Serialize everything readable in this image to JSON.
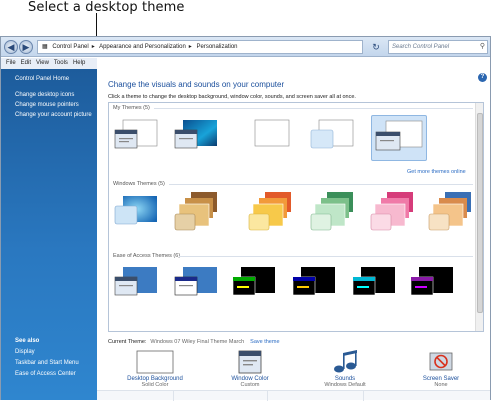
{
  "callout": {
    "text": "Select a desktop theme"
  },
  "address": {
    "crumbs": [
      "Control Panel",
      "Appearance and Personalization",
      "Personalization"
    ],
    "search_placeholder": "Search Control Panel"
  },
  "menu": [
    "File",
    "Edit",
    "View",
    "Tools",
    "Help"
  ],
  "sidebar": {
    "home": "Control Panel Home",
    "links": [
      "Change desktop icons",
      "Change mouse pointers",
      "Change your account picture"
    ],
    "see_also_label": "See also",
    "see_also": [
      "Display",
      "Taskbar and Start Menu",
      "Ease of Access Center"
    ]
  },
  "main": {
    "title": "Change the visuals and sounds on your computer",
    "subtitle": "Click a theme to change the desktop background, window color, sounds, and screen saver all at once."
  },
  "themes": {
    "my_themes": "My Themes (5)",
    "get_more": "Get more themes online",
    "windows_themes": "Windows Themes (5)",
    "ease_themes": "Ease of Access Themes (6)"
  },
  "current": {
    "label": "Current Theme:",
    "value": "Windows 07 Wiley Final Theme March",
    "save": "Save theme"
  },
  "tools": [
    {
      "label": "Desktop Background",
      "value": "Solid Color",
      "icon": "desktop-background-icon"
    },
    {
      "label": "Window Color",
      "value": "Custom",
      "icon": "window-color-icon"
    },
    {
      "label": "Sounds",
      "value": "Windows Default",
      "icon": "sounds-icon"
    },
    {
      "label": "Screen Saver",
      "value": "None",
      "icon": "screen-saver-icon"
    }
  ],
  "colors": {
    "accent": "#1b4f9c",
    "sidebar": "#2a78c0",
    "link": "#2b6cc4"
  }
}
